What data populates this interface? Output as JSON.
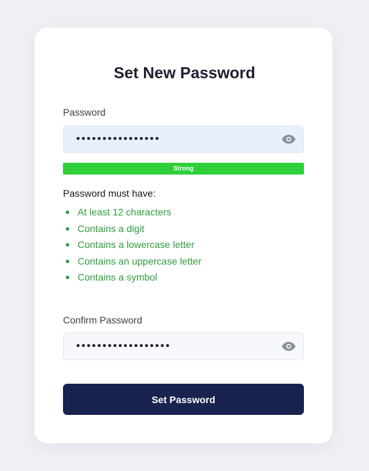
{
  "form": {
    "title": "Set New Password",
    "password": {
      "label": "Password",
      "value": "••••••••••••••••",
      "toggle_icon": "eye-icon"
    },
    "strength": {
      "label": "Strong",
      "level": 1.0,
      "color": "#2fd03a"
    },
    "requirements": {
      "title": "Password must have:",
      "color": "#2e9c3d",
      "items": [
        "At least 12 characters",
        "Contains a digit",
        "Contains a lowercase letter",
        "Contains an uppercase letter",
        "Contains a symbol"
      ]
    },
    "confirm": {
      "label": "Confirm Password",
      "value": "••••••••••••••••••",
      "toggle_icon": "eye-icon"
    },
    "submit_label": "Set Password"
  },
  "colors": {
    "page_background": "#f1eff4",
    "card_background": "#ffffff",
    "focused_input_bg": "#e8f0fd",
    "input_bg": "#f6f8fb",
    "button_bg": "#18244f"
  }
}
